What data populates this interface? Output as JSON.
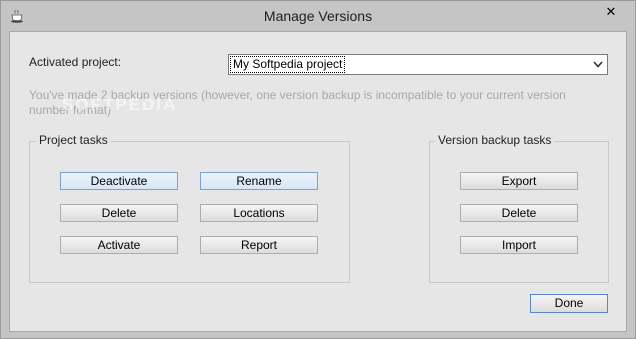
{
  "window": {
    "title": "Manage Versions",
    "close_label": "✕"
  },
  "activated_project": {
    "label": "Activated project:",
    "selected_value": "My Softpedia project"
  },
  "info_text": "You've made 2 backup versions (however, one version backup is incompatible to your current version number format)",
  "watermark": "SOFTPEDIA",
  "project_tasks": {
    "legend": "Project tasks",
    "buttons": {
      "deactivate": "Deactivate",
      "rename": "Rename",
      "delete": "Delete",
      "locations": "Locations",
      "activate": "Activate",
      "report": "Report"
    }
  },
  "version_tasks": {
    "legend": "Version backup tasks",
    "buttons": {
      "export": "Export",
      "delete": "Delete",
      "import": "Import"
    }
  },
  "done_label": "Done",
  "icons": {
    "app": "coffee-cup-icon",
    "close": "close-icon",
    "dropdown": "chevron-down-icon"
  },
  "colors": {
    "window_frame": "#c5c5c5",
    "client_bg": "#e6e6e6",
    "info_text": "#a8a8a8",
    "focus_border": "#7da2ce"
  }
}
